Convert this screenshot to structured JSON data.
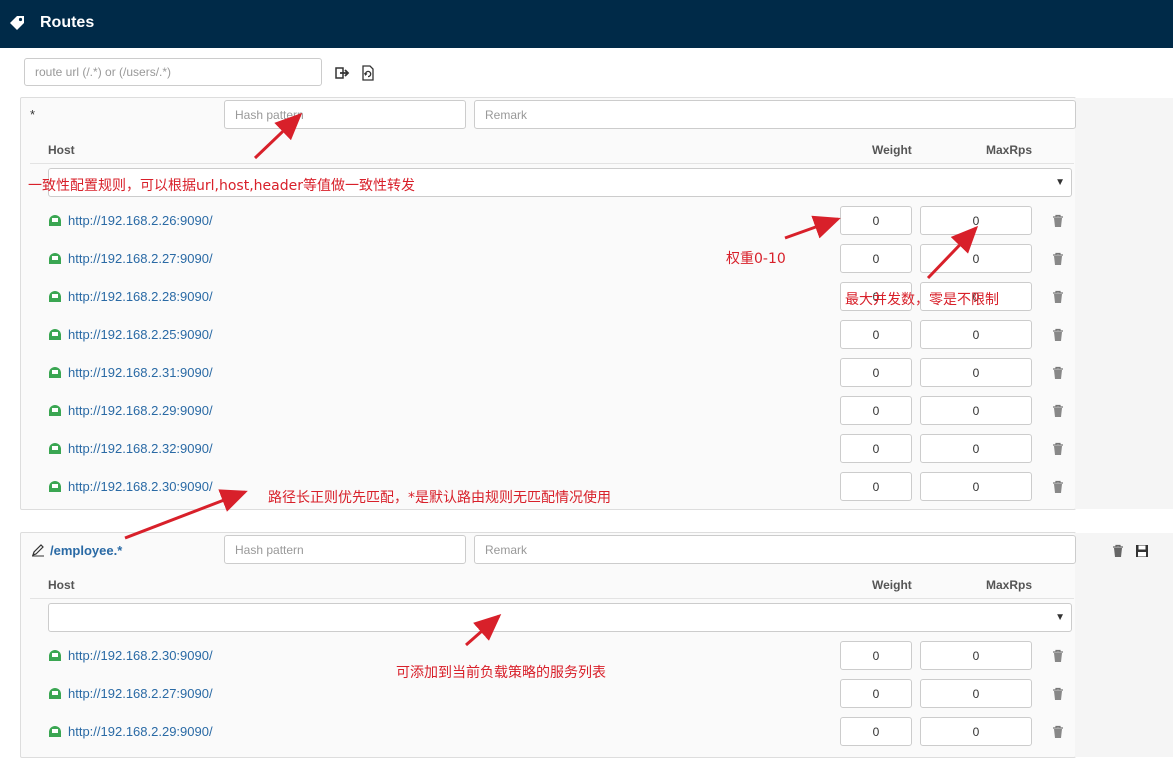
{
  "header": {
    "title": "Routes"
  },
  "search": {
    "placeholder": "route url (/.*) or (/users/.*)"
  },
  "columns": {
    "host": "Host",
    "weight": "Weight",
    "maxrps": "MaxRps"
  },
  "routes": [
    {
      "name": "*",
      "hash_placeholder": "Hash pattern",
      "remark_placeholder": "Remark",
      "hosts": [
        {
          "url": "http://192.168.2.26:9090/",
          "weight": "0",
          "maxrps": "0"
        },
        {
          "url": "http://192.168.2.27:9090/",
          "weight": "0",
          "maxrps": "0"
        },
        {
          "url": "http://192.168.2.28:9090/",
          "weight": "0",
          "maxrps": "0"
        },
        {
          "url": "http://192.168.2.25:9090/",
          "weight": "0",
          "maxrps": "0"
        },
        {
          "url": "http://192.168.2.31:9090/",
          "weight": "0",
          "maxrps": "0"
        },
        {
          "url": "http://192.168.2.29:9090/",
          "weight": "0",
          "maxrps": "0"
        },
        {
          "url": "http://192.168.2.32:9090/",
          "weight": "0",
          "maxrps": "0"
        },
        {
          "url": "http://192.168.2.30:9090/",
          "weight": "0",
          "maxrps": "0"
        }
      ]
    },
    {
      "name": "/employee.*",
      "hash_placeholder": "Hash pattern",
      "remark_placeholder": "Remark",
      "hosts": [
        {
          "url": "http://192.168.2.30:9090/",
          "weight": "0",
          "maxrps": "0"
        },
        {
          "url": "http://192.168.2.27:9090/",
          "weight": "0",
          "maxrps": "0"
        },
        {
          "url": "http://192.168.2.29:9090/",
          "weight": "0",
          "maxrps": "0"
        }
      ]
    }
  ],
  "annotations": {
    "hash": "一致性配置规则，可以根据url,host,header等值做一致性转发",
    "weight": "权重0-10",
    "maxrps": "最大并发数，零是不限制",
    "path": "路径长正则优先匹配，*是默认路由规则无匹配情况使用",
    "services": "可添加到当前负载策略的服务列表"
  },
  "colors": {
    "header_bg": "#002a48",
    "link": "#2a6aa5",
    "annotation": "#d8202a",
    "host_icon": "#3aa652"
  }
}
